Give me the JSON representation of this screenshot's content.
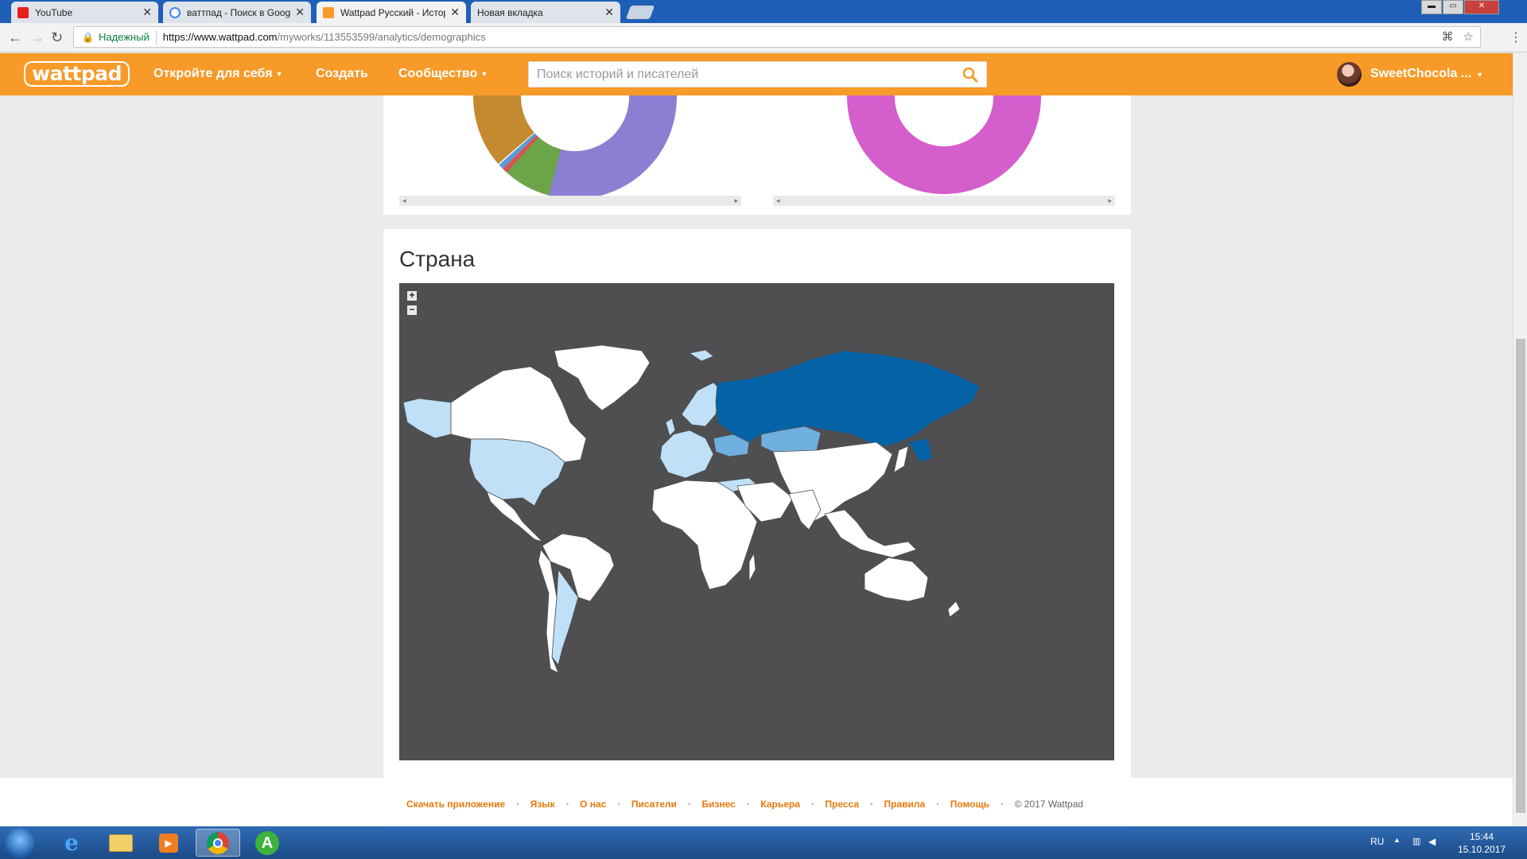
{
  "browser": {
    "tabs": [
      {
        "title": "YouTube",
        "favicon_color": "#e62117",
        "active": false
      },
      {
        "title": "ваттпад - Поиск в Google",
        "favicon_color": "#4285f4",
        "active": false
      },
      {
        "title": "Wattpad Русский - Истори",
        "favicon_color": "#f89a27",
        "active": true
      },
      {
        "title": "Новая вкладка",
        "favicon_color": "",
        "active": false
      }
    ],
    "secure_label": "Надежный",
    "url_domain": "https://www.wattpad.com",
    "url_path": "/myworks/113553599/analytics/demographics",
    "window_controls": [
      "▬",
      "▭",
      "✕"
    ]
  },
  "header": {
    "logo_text": "wattpad",
    "nav": [
      "Откройте для себя",
      "Создать",
      "Сообщество"
    ],
    "search_placeholder": "Поиск историй и писателей",
    "username": "SweetChocola ..."
  },
  "colors": {
    "brand_orange": "#f89a27",
    "map_background": "#4f4e51",
    "country_top": "#0563a8",
    "country_mid": "#6fb0e0",
    "country_low": "#bfe0f7",
    "country_none": "#ffffff",
    "donut_purple": "#8b7fd3",
    "donut_green": "#6ba547",
    "donut_brown": "#c48a2f",
    "donut_magenta": "#d45ecb"
  },
  "country_section": {
    "title": "Страна",
    "zoom_in": "+",
    "zoom_out": "−",
    "map": {
      "highlighted": [
        {
          "country": "Russia",
          "level": "top"
        },
        {
          "country": "Kazakhstan",
          "level": "mid"
        },
        {
          "country": "Ukraine",
          "level": "mid"
        },
        {
          "country": "United States",
          "level": "low"
        },
        {
          "country": "Alaska",
          "level": "low"
        },
        {
          "country": "Argentina",
          "level": "low"
        },
        {
          "country": "Europe (various)",
          "level": "low"
        }
      ]
    }
  },
  "footer": {
    "links": [
      "Скачать приложение",
      "Язык",
      "О нас",
      "Писатели",
      "Бизнес",
      "Карьера",
      "Пресса",
      "Правила",
      "Помощь"
    ],
    "copyright": "© 2017 Wattpad"
  },
  "taskbar": {
    "lang": "RU",
    "time": "15:44",
    "date": "15.10.2017"
  }
}
